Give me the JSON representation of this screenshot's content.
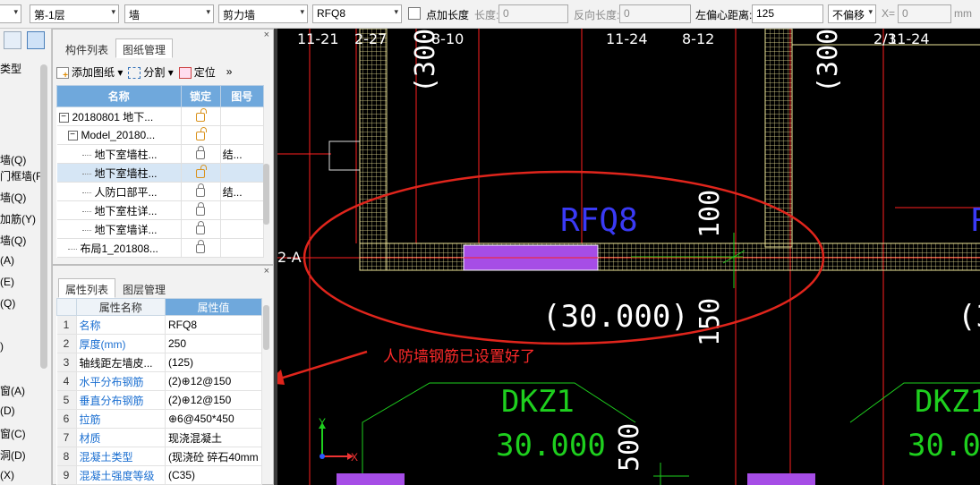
{
  "toolbar": {
    "floor": "第-1层",
    "category": "墙",
    "subtype": "剪力墙",
    "component": "RFQ8",
    "add_length_label": "点加长度",
    "length_label": "长度:",
    "length_value": "0",
    "reverse_length_label": "反向长度:",
    "reverse_length_value": "0",
    "offset_label": "左偏心距离:",
    "offset_value": "125",
    "offset_mode": "不偏移",
    "x_label": "X=",
    "x_value": "0",
    "unit": "mm"
  },
  "left_strip": {
    "items": [
      "类型",
      "墙(Q)",
      "门框墙(F",
      "墙(Q)",
      "加筋(Y)",
      "墙(Q)",
      "(A)",
      "(E)",
      "(Q)",
      ")",
      "窗(A)",
      "(D)",
      "窗(C)",
      "洞(D)",
      "(X)"
    ]
  },
  "drawing_panel": {
    "tabs": [
      "构件列表",
      "图纸管理"
    ],
    "tools": [
      "添加图纸",
      "分割",
      "定位"
    ],
    "columns": [
      "名称",
      "锁定",
      "图号"
    ],
    "rows": [
      {
        "name": "20180801 地下...",
        "lock": "open",
        "num": "",
        "level": 0,
        "expand": "−"
      },
      {
        "name": "Model_20180...",
        "lock": "open",
        "num": "",
        "level": 1,
        "expand": "−"
      },
      {
        "name": "地下室墙柱...",
        "lock": "closed",
        "num": "结...",
        "level": 2,
        "expand": ""
      },
      {
        "name": "地下室墙柱...",
        "lock": "open",
        "num": "",
        "level": 2,
        "expand": "",
        "selected": true
      },
      {
        "name": "人防口部平...",
        "lock": "closed",
        "num": "结...",
        "level": 2,
        "expand": ""
      },
      {
        "name": "地下室柱详...",
        "lock": "closed",
        "num": "",
        "level": 2,
        "expand": ""
      },
      {
        "name": "地下室墙详...",
        "lock": "closed",
        "num": "",
        "level": 2,
        "expand": ""
      },
      {
        "name": "布局1_201808...",
        "lock": "closed",
        "num": "",
        "level": 1,
        "expand": ""
      }
    ]
  },
  "property_panel": {
    "tabs": [
      "属性列表",
      "图层管理"
    ],
    "columns": [
      "属性名称",
      "属性值"
    ],
    "rows": [
      {
        "num": "1",
        "name": "名称",
        "value": "RFQ8",
        "blue": true
      },
      {
        "num": "2",
        "name": "厚度(mm)",
        "value": "250",
        "blue": true
      },
      {
        "num": "3",
        "name": "轴线距左墙皮...",
        "value": "(125)",
        "blue": false
      },
      {
        "num": "4",
        "name": "水平分布钢筋",
        "value": "(2)⊕12@150",
        "blue": true
      },
      {
        "num": "5",
        "name": "垂直分布钢筋",
        "value": "(2)⊕12@150",
        "blue": true
      },
      {
        "num": "6",
        "name": "拉筋",
        "value": "⊕6@450*450",
        "blue": true
      },
      {
        "num": "7",
        "name": "材质",
        "value": "现浇混凝土",
        "blue": true
      },
      {
        "num": "8",
        "name": "混凝土类型",
        "value": "(现浇砼 碎石40mm",
        "blue": true
      },
      {
        "num": "9",
        "name": "混凝土强度等级",
        "value": "(C35)",
        "blue": true
      }
    ]
  },
  "canvas": {
    "top_labels": [
      "11-21",
      "2-27",
      "8-10",
      "11-24",
      "8-12",
      "11-24",
      "2/3"
    ],
    "wall_label": "RFQ8",
    "wall_label_right": "R",
    "axis_label": "2-A",
    "elevation": "(30.000)",
    "elevation_right": "(3",
    "dim_100": "100",
    "dim_150": "150",
    "dim_500": "500",
    "dim_300": "(300)",
    "dkz_left": "DKZ1",
    "dkz_right": "DKZ1",
    "dkz_elev": "30.000",
    "axis_x": "X",
    "axis_y": "Y",
    "annotation": "人防墙钢筋已设置好了",
    "colors": {
      "wall_fill": "#a64de6",
      "annotation": "#ff2a2a",
      "grid_red": "#ff2020",
      "green_text": "#1ecf1e",
      "blue_text": "#3a3af5",
      "wall_mesh": "#f1e79a"
    }
  },
  "icons": [
    "add-drawing-icon",
    "split-icon",
    "locate-icon",
    "lock-icon",
    "unlock-icon",
    "close-icon",
    "dropdown-icon"
  ]
}
